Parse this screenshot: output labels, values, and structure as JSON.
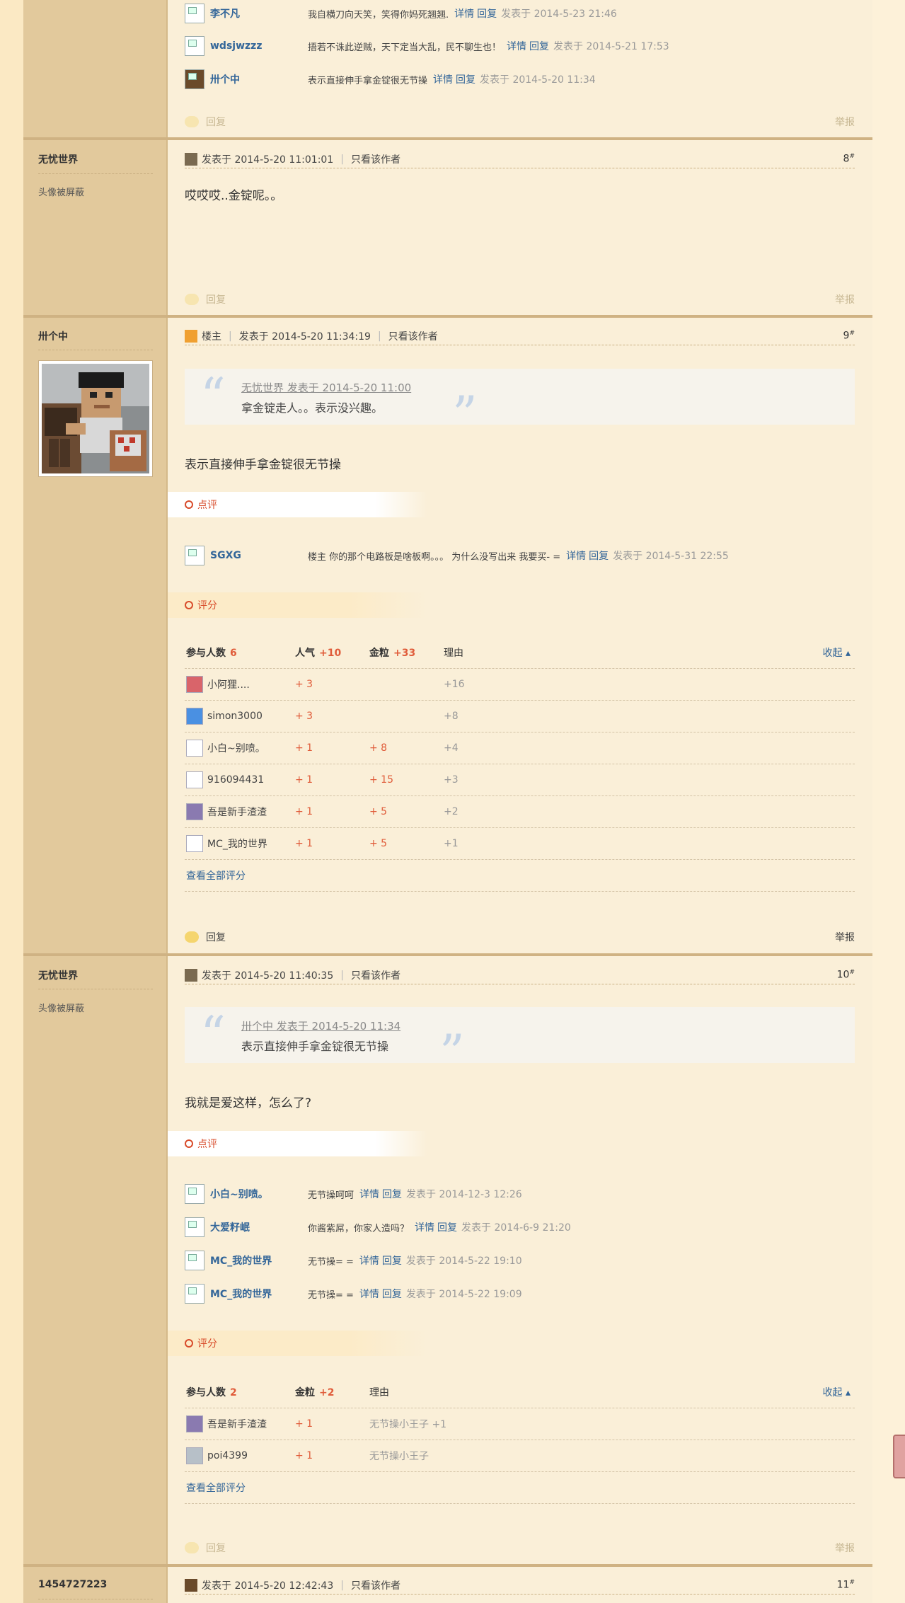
{
  "top_comments": [
    {
      "name": "李不凡",
      "text": "我自横刀向天笑，笑得你妈死翘翘.",
      "detail": "详情",
      "reply": "回复",
      "time": "发表于 2014-5-23 21:46"
    },
    {
      "name": "wdsjwzzz",
      "text": "捂若不诛此逆贼，天下定当大乱，民不聊生也！",
      "detail": "详情",
      "reply": "回复",
      "time": "发表于 2014-5-21 17:53"
    },
    {
      "name": "卅个中",
      "text": "表示直接伸手拿金锭很无节操",
      "detail": "详情",
      "reply": "回复",
      "time": "发表于 2014-5-20 11:34"
    }
  ],
  "footer": {
    "reply": "回复",
    "report": "举报"
  },
  "posts": {
    "p8": {
      "author": "无忧世界",
      "avatar_note": "头像被屏蔽",
      "posted": "发表于 2014-5-20 11:01:01",
      "only_author": "只看该作者",
      "floor": "8",
      "content": "哎哎哎..金锭呢。。"
    },
    "p9": {
      "author": "卅个中",
      "badge": "楼主",
      "posted": "发表于 2014-5-20 11:34:19",
      "only_author": "只看该作者",
      "floor": "9",
      "quote_head": "无忧世界 发表于 2014-5-20 11:00",
      "quote_text": "拿金锭走人。。表示没兴趣。",
      "content": "表示直接伸手拿金锭很无节操",
      "dianping_label": "点评",
      "comment": {
        "name": "SGXG",
        "text": "楼主 你的那个电路板是啥板啊。。。 为什么没写出来 我要买- =",
        "detail": "详情",
        "reply": "回复",
        "time": "发表于 2014-5-31 22:55"
      },
      "pingfen_label": "评分",
      "rate_head": {
        "participants": "参与人数",
        "count": "6",
        "col1": "人气",
        "col1_total": "+10",
        "col2": "金粒",
        "col2_total": "+33",
        "reason": "理由",
        "collapse": "收起"
      },
      "rates": [
        {
          "user": "小阿狸....",
          "c1": "+ 3",
          "c2": "",
          "reason": "+16"
        },
        {
          "user": "simon3000",
          "c1": "+ 3",
          "c2": "",
          "reason": "+8"
        },
        {
          "user": "小白~别喷。",
          "c1": "+ 1",
          "c2": "+ 8",
          "reason": "+4"
        },
        {
          "user": "916094431",
          "c1": "+ 1",
          "c2": "+ 15",
          "reason": "+3"
        },
        {
          "user": "吾是新手渣渣",
          "c1": "+ 1",
          "c2": "+ 5",
          "reason": "+2"
        },
        {
          "user": "MC_我的世界",
          "c1": "+ 1",
          "c2": "+ 5",
          "reason": "+1"
        }
      ],
      "view_all": "查看全部评分"
    },
    "p10": {
      "author": "无忧世界",
      "avatar_note": "头像被屏蔽",
      "posted": "发表于 2014-5-20 11:40:35",
      "only_author": "只看该作者",
      "floor": "10",
      "quote_head": "卅个中 发表于 2014-5-20 11:34",
      "quote_text": "表示直接伸手拿金锭很无节操",
      "content": "我就是爱这样，怎么了?",
      "dianping_label": "点评",
      "comments": [
        {
          "name": "小白~别喷。",
          "text": "无节操呵呵",
          "detail": "详情",
          "reply": "回复",
          "time": "发表于 2014-12-3 12:26"
        },
        {
          "name": "大爱籽岷",
          "text": "你酱紫屌，你家人造吗？",
          "detail": "详情",
          "reply": "回复",
          "time": "发表于 2014-6-9 21:20"
        },
        {
          "name": "MC_我的世界",
          "text": "无节操= =",
          "detail": "详情",
          "reply": "回复",
          "time": "发表于 2014-5-22 19:10"
        },
        {
          "name": "MC_我的世界",
          "text": "无节操= =",
          "detail": "详情",
          "reply": "回复",
          "time": "发表于 2014-5-22 19:09"
        }
      ],
      "pingfen_label": "评分",
      "rate_head": {
        "participants": "参与人数",
        "count": "2",
        "col1": "金粒",
        "col1_total": "+2",
        "reason": "理由",
        "collapse": "收起"
      },
      "rates": [
        {
          "user": "吾是新手渣渣",
          "c1": "+ 1",
          "reason": "无节操小王子 +1"
        },
        {
          "user": "poi4399",
          "c1": "+ 1",
          "reason": "无节操小王子"
        }
      ],
      "view_all": "查看全部评分"
    },
    "p11": {
      "author": "1454727223",
      "posted": "发表于 2014-5-20 12:42:43",
      "only_author": "只看该作者",
      "floor": "11"
    }
  }
}
